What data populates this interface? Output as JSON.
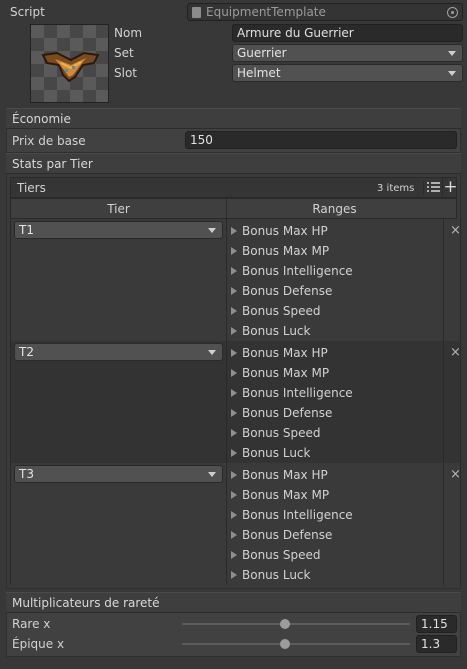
{
  "script": {
    "label": "Script",
    "value": "EquipmentTemplate"
  },
  "fields": {
    "nom_label": "Nom",
    "nom_value": "Armure du Guerrier",
    "set_label": "Set",
    "set_value": "Guerrier",
    "slot_label": "Slot",
    "slot_value": "Helmet"
  },
  "economie": {
    "header": "Économie",
    "prix_label": "Prix de base",
    "prix_value": "150"
  },
  "stats": {
    "header": "Stats par Tier",
    "list_title": "Tiers",
    "count": "3 items",
    "col_tier": "Tier",
    "col_ranges": "Ranges",
    "range_labels": [
      "Bonus Max HP",
      "Bonus Max MP",
      "Bonus Intelligence",
      "Bonus Defense",
      "Bonus Speed",
      "Bonus Luck"
    ],
    "tiers": [
      {
        "value": "T1"
      },
      {
        "value": "T2"
      },
      {
        "value": "T3"
      }
    ]
  },
  "rarete": {
    "header": "Multiplicateurs de rareté",
    "rare_label": "Rare x",
    "rare_value": "1.15",
    "rare_fraction": 0.45,
    "epique_label": "Épique x",
    "epique_value": "1.3",
    "epique_fraction": 0.45
  },
  "colors": {
    "background": "#383838",
    "field": "#2a2a2a",
    "dropdown": "#515151",
    "row_alt": "#353535"
  },
  "icons": [
    "script-file-icon",
    "object-picker-icon",
    "list-view-icon",
    "add-icon",
    "remove-icon",
    "foldout-arrow-icon",
    "dropdown-caret-icon"
  ]
}
